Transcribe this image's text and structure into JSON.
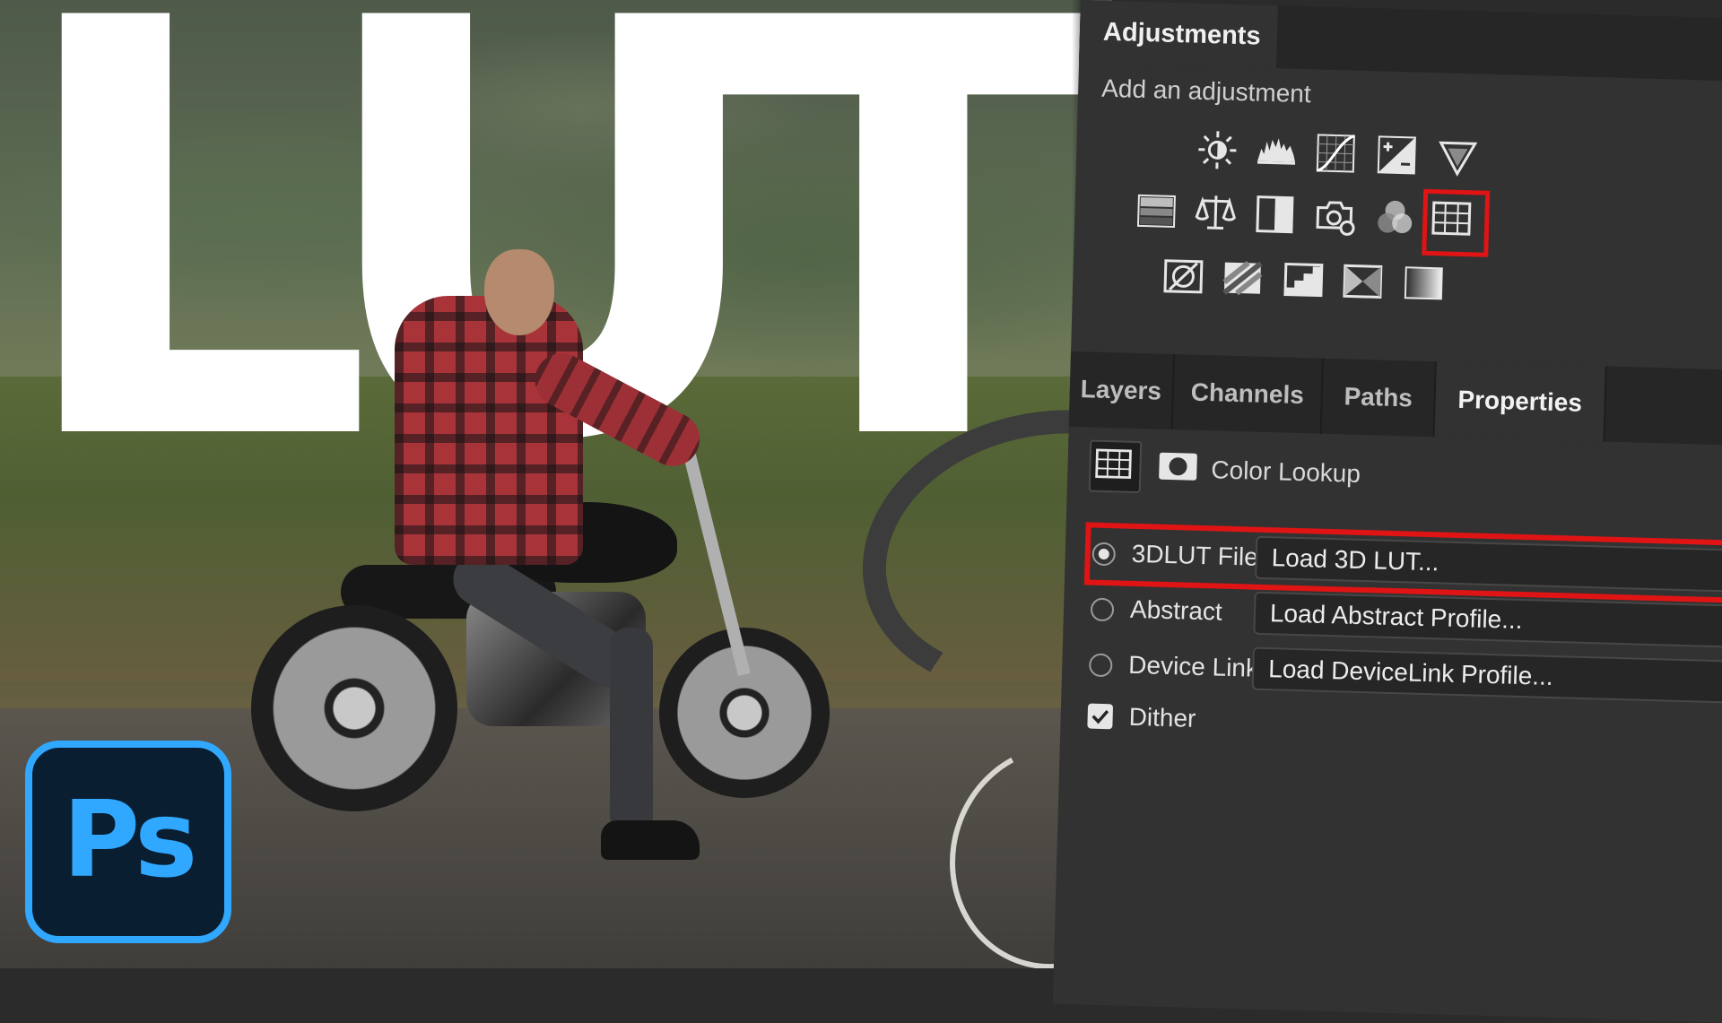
{
  "thumbnail": {
    "headline": "LUT",
    "letters": [
      "L",
      "U",
      "T"
    ],
    "app_logo_text": "Ps",
    "app_logo_color": "#31a8ff",
    "highlight_color": "#e01414"
  },
  "adjustments_panel": {
    "tab_title": "Adjustments",
    "subtitle": "Add an adjustment",
    "icons_row1": [
      "brightness-contrast-icon",
      "levels-icon",
      "curves-icon",
      "exposure-icon",
      "vibrance-icon"
    ],
    "icons_row2": [
      "hue-saturation-icon",
      "color-balance-icon",
      "black-white-icon",
      "photo-filter-icon",
      "channel-mixer-icon",
      "color-lookup-icon"
    ],
    "icons_row3": [
      "invert-icon",
      "posterize-icon",
      "threshold-icon",
      "selective-color-icon",
      "gradient-map-icon"
    ],
    "selected_icon": "color-lookup-icon"
  },
  "lower_tabs": [
    "Layers",
    "Channels",
    "Paths",
    "Properties"
  ],
  "active_tab": "Properties",
  "properties": {
    "title": "Color Lookup",
    "rows": [
      {
        "label": "3DLUT File",
        "button": "Load 3D LUT...",
        "selected": true
      },
      {
        "label": "Abstract",
        "button": "Load Abstract Profile...",
        "selected": false
      },
      {
        "label": "Device Link",
        "button": "Load DeviceLink Profile...",
        "selected": false
      }
    ],
    "dither_label": "Dither",
    "dither_checked": true
  }
}
